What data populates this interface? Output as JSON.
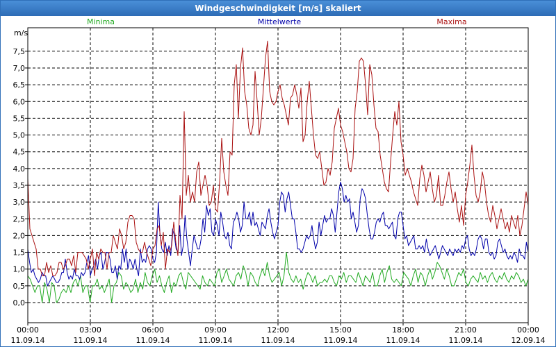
{
  "window": {
    "title": "Windgeschwindigkeit [m/s] skaliert"
  },
  "chart_data": {
    "type": "line",
    "title": "Windgeschwindigkeit [m/s] skaliert",
    "ylabel": "m/s",
    "ylim": [
      -0.6,
      8.2
    ],
    "yticks": [
      "0,0",
      "0,5",
      "1,0",
      "1,5",
      "2,0",
      "2,5",
      "3,0",
      "3,5",
      "4,0",
      "4,5",
      "5,0",
      "5,5",
      "6,0",
      "6,5",
      "7,0",
      "7,5"
    ],
    "x_tick_time": [
      "00:00",
      "03:00",
      "06:00",
      "09:00",
      "12:00",
      "15:00",
      "18:00",
      "21:00",
      "00:00"
    ],
    "x_tick_date": [
      "11.09.14",
      "11.09.14",
      "11.09.14",
      "11.09.14",
      "11.09.14",
      "11.09.14",
      "11.09.14",
      "11.09.14",
      "12.09.14"
    ],
    "grid": true,
    "legend_placement": "top",
    "series": [
      {
        "name": "Minima",
        "color": "#22aa22",
        "values": [
          0.8,
          0.7,
          0.5,
          0.3,
          0.5,
          0.5,
          0.0,
          0.6,
          0.4,
          0.0,
          0.6,
          0.5,
          0.0,
          0.1,
          0.3,
          0.4,
          0.3,
          0.5,
          0.3,
          0.6,
          0.7,
          0.5,
          0.8,
          0.3,
          0.5,
          0.5,
          0.0,
          0.5,
          0.5,
          0.7,
          0.4,
          0.5,
          0.3,
          0.5,
          0.7,
          0.0,
          0.5,
          0.6,
          0.9,
          0.8,
          0.4,
          0.6,
          0.5,
          0.3,
          0.4,
          0.7,
          0.3,
          0.6,
          0.4,
          0.9,
          0.6,
          0.5,
          0.8,
          1.0,
          0.6,
          0.8,
          0.5,
          0.3,
          0.6,
          0.8,
          0.3,
          0.6,
          0.5,
          0.8,
          0.9,
          0.6,
          0.4,
          0.9,
          0.8,
          0.7,
          0.6,
          0.5,
          0.4,
          0.8,
          0.6,
          0.5,
          0.7,
          0.6,
          0.5,
          0.9,
          1.0,
          0.6,
          0.8,
          1.0,
          0.7,
          0.6,
          0.5,
          0.8,
          0.9,
          0.7,
          1.1,
          0.9,
          0.5,
          0.9,
          0.8,
          0.6,
          0.5,
          0.8,
          1.0,
          0.8,
          1.2,
          0.8,
          0.6,
          0.7,
          0.8,
          0.9,
          0.5,
          0.8,
          1.5,
          0.9,
          0.7,
          0.6,
          0.8,
          0.6,
          0.7,
          0.4,
          0.7,
          0.9,
          0.8,
          0.6,
          0.8,
          0.5,
          0.6,
          0.6,
          0.7,
          0.6,
          0.8,
          0.8,
          0.6,
          0.5,
          0.8,
          0.7,
          0.9,
          0.6,
          0.8,
          0.8,
          0.7,
          0.6,
          0.9,
          0.7,
          0.5,
          0.8,
          0.7,
          0.6,
          0.9,
          0.5,
          0.5,
          0.8,
          1.0,
          0.6,
          0.9,
          1.1,
          0.7,
          0.6,
          0.7,
          0.6,
          0.5,
          0.9,
          0.8,
          0.7,
          0.5,
          0.8,
          1.0,
          0.6,
          0.9,
          0.8,
          0.5,
          0.8,
          1.0,
          0.7,
          0.9,
          1.2,
          1.1,
          0.9,
          0.7,
          1.0,
          0.8,
          0.5,
          0.5,
          0.7,
          0.9,
          0.8,
          1.0,
          0.6,
          0.5,
          0.7,
          0.8,
          0.7,
          0.6,
          0.9,
          0.7,
          0.8,
          0.6,
          0.8,
          0.9,
          0.7,
          0.6,
          0.8,
          0.7,
          0.9,
          0.7,
          0.6,
          0.8,
          0.7,
          0.9,
          0.8,
          0.6,
          0.7,
          0.5,
          0.7
        ]
      },
      {
        "name": "Mittelwerte",
        "color": "#0000aa",
        "values": [
          1.6,
          1.2,
          0.9,
          1.0,
          0.8,
          0.7,
          0.6,
          0.7,
          0.9,
          0.8,
          0.8,
          0.5,
          0.6,
          0.7,
          0.8,
          0.7,
          0.6,
          0.6,
          0.7,
          0.9,
          0.9,
          1.3,
          0.9,
          0.7,
          0.8,
          0.7,
          1.0,
          0.8,
          0.8,
          0.7,
          0.9,
          0.8,
          0.9,
          1.2,
          1.4,
          0.8,
          1.0,
          1.1,
          1.3,
          1.0,
          1.4,
          1.5,
          1.0,
          1.2,
          1.5,
          1.5,
          1.3,
          0.9,
          0.9,
          1.1,
          0.7,
          1.1,
          1.0,
          1.6,
          1.2,
          1.6,
          1.0,
          1.3,
          1.2,
          1.0,
          1.3,
          1.0,
          0.8,
          1.6,
          1.2,
          1.3,
          1.2,
          1.6,
          1.7,
          1.6,
          1.3,
          1.2,
          1.5,
          3.0,
          2.0,
          1.6,
          1.5,
          1.8,
          1.4,
          1.7,
          1.4,
          2.2,
          2.0,
          1.6,
          1.5,
          2.3,
          1.4,
          1.7,
          2.6,
          1.9,
          1.5,
          1.1,
          1.6,
          2.0,
          1.8,
          1.6,
          1.6,
          1.9,
          2.5,
          2.1,
          2.9,
          2.6,
          2.8,
          2.1,
          2.0,
          2.5,
          2.3,
          2.0,
          2.7,
          2.4,
          2.0,
          1.9,
          2.1,
          1.7,
          1.6,
          2.4,
          2.5,
          2.7,
          2.5,
          2.1,
          2.3,
          3.0,
          2.5,
          2.5,
          2.7,
          2.3,
          2.7,
          2.3,
          2.4,
          2.2,
          2.0,
          2.4,
          2.3,
          2.2,
          2.6,
          2.8,
          2.4,
          2.1,
          1.9,
          2.1,
          2.3,
          3.0,
          3.3,
          3.2,
          2.7,
          3.1,
          3.3,
          2.9,
          2.5,
          2.5,
          2.1,
          1.6,
          1.6,
          1.5,
          1.6,
          1.8,
          2.0,
          1.9,
          2.0,
          2.3,
          1.9,
          1.6,
          1.8,
          2.4,
          2.0,
          2.3,
          2.6,
          2.4,
          2.5,
          2.5,
          2.8,
          2.6,
          2.1,
          2.7,
          3.3,
          3.6,
          3.4,
          3.0,
          3.2,
          3.0,
          3.1,
          2.5,
          2.7,
          2.4,
          2.1,
          2.3,
          3.1,
          3.4,
          3.3,
          3.1,
          2.6,
          2.2,
          1.9,
          1.9,
          2.1,
          2.4,
          2.5,
          2.4,
          2.6,
          2.7,
          2.3,
          2.3,
          2.2,
          2.3,
          2.4,
          2.0,
          1.9,
          2.5,
          2.7,
          2.7,
          2.3,
          1.9,
          2.0,
          1.7,
          1.8,
          1.9,
          2.0,
          1.6,
          1.6,
          1.7,
          1.6,
          1.7,
          1.5,
          1.9,
          1.6,
          1.4,
          1.5,
          1.6,
          1.7,
          1.5,
          1.3,
          1.5,
          1.7,
          1.6,
          1.5,
          1.4,
          1.6,
          1.5,
          1.4,
          1.6,
          1.5,
          1.6,
          1.5,
          1.7,
          1.6,
          1.9,
          2.0,
          1.6,
          1.4,
          1.5,
          1.4,
          1.6,
          1.9,
          2.0,
          1.9,
          1.6,
          1.9,
          1.9,
          1.5,
          1.4,
          1.5,
          1.3,
          1.4,
          1.8,
          1.9,
          1.7,
          1.5,
          1.6,
          1.4,
          1.3,
          1.4,
          1.3,
          1.5,
          1.4,
          1.2,
          1.6,
          1.4,
          1.4,
          1.3,
          1.8,
          1.5
        ]
      },
      {
        "name": "Maxima",
        "color": "#aa1111",
        "values": [
          3.7,
          2.2,
          2.0,
          1.8,
          1.6,
          1.0,
          1.0,
          0.8,
          0.8,
          1.2,
          0.9,
          1.1,
          0.8,
          0.8,
          0.9,
          1.2,
          1.2,
          1.0,
          1.1,
          1.3,
          1.3,
          1.1,
          1.4,
          0.9,
          1.5,
          1.5,
          1.5,
          1.4,
          1.3,
          1.0,
          1.3,
          1.6,
          0.8,
          1.5,
          1.3,
          1.6,
          1.5,
          1.5,
          1.0,
          1.5,
          1.5,
          2.0,
          1.8,
          1.6,
          2.2,
          2.0,
          1.6,
          1.8,
          2.4,
          2.6,
          2.6,
          2.5,
          1.8,
          1.6,
          1.5,
          1.5,
          1.8,
          1.5,
          1.3,
          1.1,
          1.6,
          1.7,
          2.2,
          2.3,
          1.7,
          2.1,
          1.0,
          1.6,
          1.5,
          1.7,
          2.4,
          1.8,
          1.4,
          3.2,
          2.5,
          5.7,
          3.2,
          3.8,
          3.0,
          3.3,
          3.0,
          3.9,
          4.2,
          3.2,
          3.5,
          3.8,
          3.5,
          2.9,
          3.0,
          3.5,
          2.8,
          2.7,
          3.6,
          4.9,
          3.9,
          3.5,
          3.2,
          4.5,
          4.4,
          6.5,
          7.1,
          5.5,
          7.0,
          7.6,
          6.3,
          5.9,
          5.2,
          5.0,
          5.3,
          6.9,
          6.0,
          5.0,
          5.5,
          6.4,
          7.3,
          7.8,
          6.3,
          6.0,
          5.9,
          6.0,
          6.3,
          6.5,
          6.1,
          5.9,
          5.6,
          5.3,
          6.1,
          6.2,
          6.5,
          6.2,
          5.8,
          6.4,
          4.8,
          5.0,
          6.0,
          6.6,
          5.8,
          5.0,
          4.4,
          4.3,
          4.5,
          4.0,
          3.5,
          3.6,
          4.0,
          3.8,
          4.2,
          5.2,
          5.5,
          5.8,
          5.3,
          5.1,
          4.8,
          4.5,
          4.0,
          3.9,
          4.3,
          5.8,
          6.3,
          7.2,
          7.3,
          7.2,
          6.5,
          5.6,
          7.1,
          6.8,
          5.9,
          5.2,
          5.1,
          4.4,
          4.0,
          3.6,
          3.4,
          3.3,
          4.2,
          5.0,
          5.7,
          5.3,
          6.0,
          4.8,
          4.4,
          3.8,
          4.0,
          3.8,
          3.6,
          3.3,
          3.1,
          2.9,
          3.7,
          4.1,
          3.8,
          3.3,
          3.6,
          3.9,
          3.4,
          3.0,
          3.2,
          3.8,
          2.9,
          2.9,
          3.2,
          3.6,
          3.9,
          3.4,
          3.0,
          3.3,
          2.8,
          2.4,
          2.9,
          2.3,
          3.2,
          3.6,
          4.1,
          4.7,
          3.8,
          3.2,
          3.0,
          3.3,
          3.9,
          3.6,
          3.0,
          2.6,
          2.4,
          2.9,
          2.6,
          2.2,
          2.5,
          2.8,
          2.5,
          2.2,
          2.4,
          2.1,
          2.6,
          2.4,
          2.2,
          2.6,
          2.0,
          2.3,
          2.8,
          3.3,
          2.9
        ]
      }
    ]
  }
}
